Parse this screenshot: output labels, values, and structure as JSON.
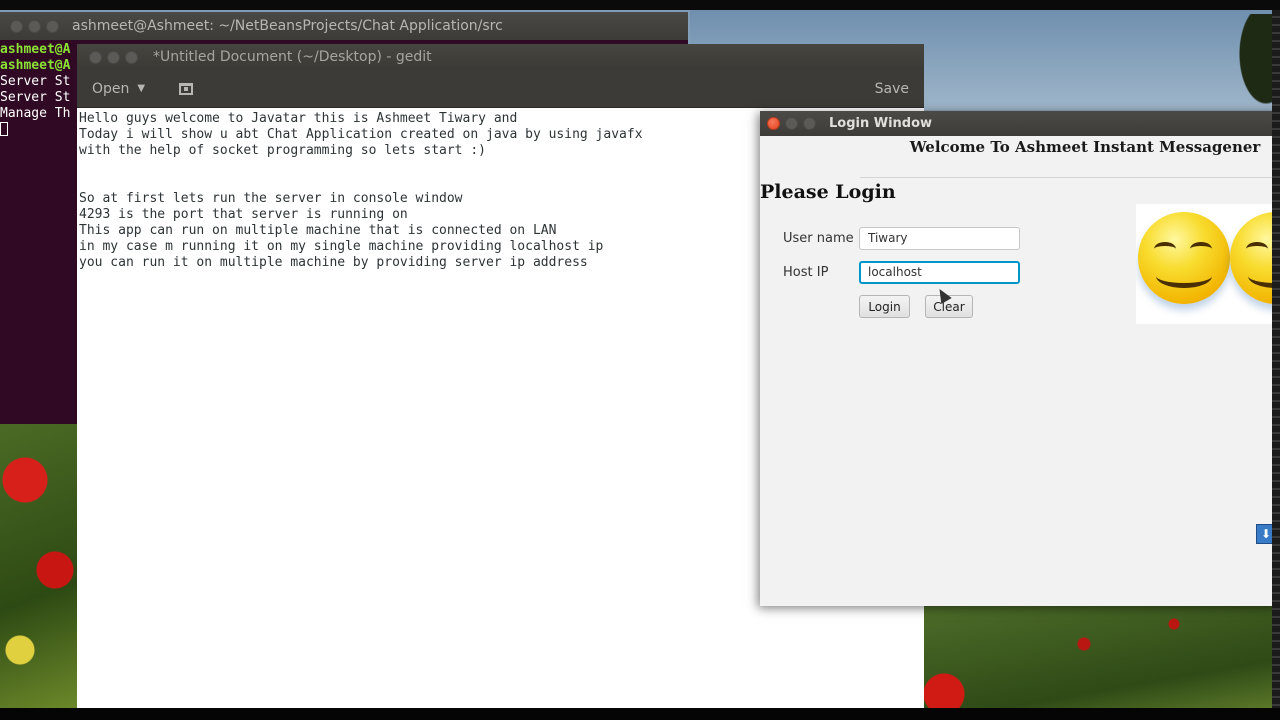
{
  "terminal": {
    "title": "ashmeet@Ashmeet: ~/NetBeansProjects/Chat Application/src",
    "lines": [
      {
        "text": "ashmeet@A",
        "prompt": true
      },
      {
        "text": "ashmeet@A",
        "prompt": true
      },
      {
        "text": "Server St",
        "prompt": false
      },
      {
        "text": "Server St",
        "prompt": false
      },
      {
        "text": "Manage Th",
        "prompt": false
      }
    ]
  },
  "gedit": {
    "title": "*Untitled Document (~/Desktop) - gedit",
    "toolbar": {
      "open_label": "Open",
      "open_caret_icon": "chevron-down-icon",
      "new_tab_icon": "new-tab-icon",
      "save_label": "Save"
    },
    "text_lines": [
      "Hello guys welcome to Javatar this is Ashmeet Tiwary and",
      "Today i will show u abt Chat Application created on java by using javafx",
      "with the help of socket programming so lets start :)",
      "",
      "",
      "So at first lets run the server in console window",
      "4293 is the port that server is running on",
      "This app can run on multiple machine that is connected on LAN",
      "in my case m running it on my single machine providing localhost ip",
      "you can run it on multiple machine by providing server ip address"
    ]
  },
  "login_window": {
    "title": "Login Window",
    "welcome": "Welcome To Ashmeet Instant Messagener",
    "heading": "Please Login",
    "username_label": "User name",
    "username_value": "Tiwary",
    "hostip_label": "Host IP",
    "hostip_value": "localhost",
    "login_button": "Login",
    "clear_button": "Clear"
  },
  "colors": {
    "terminal_bg": "#300a24",
    "prompt_green": "#8ae234",
    "focus_blue": "#0096c9",
    "close_button_red": "#e0421c"
  }
}
